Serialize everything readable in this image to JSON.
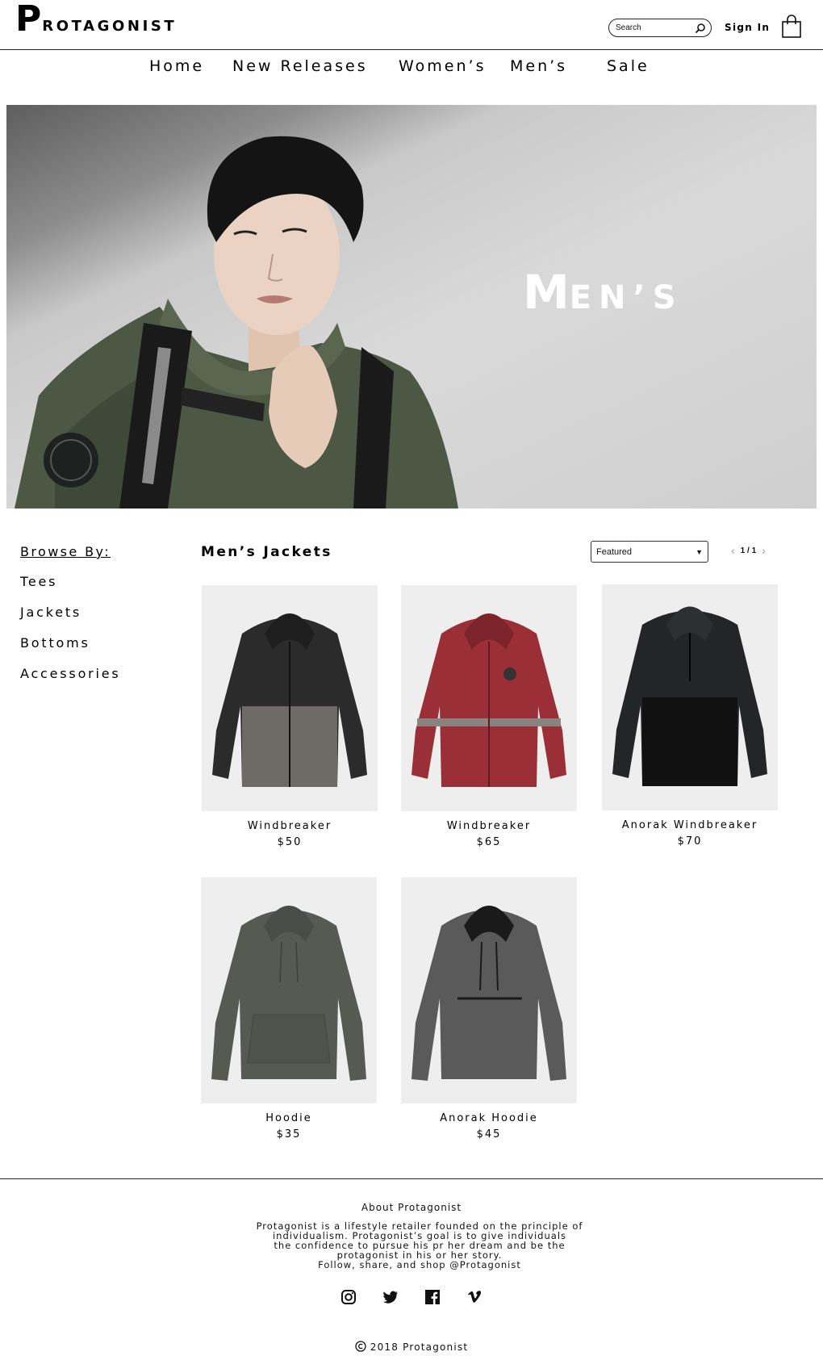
{
  "brand": {
    "initial": "P",
    "rest": "ROTAGONIST"
  },
  "header": {
    "search_placeholder": "Search",
    "signin_label": "Sign In"
  },
  "nav": {
    "items": [
      {
        "label": "Home"
      },
      {
        "label": "New Releases"
      },
      {
        "label": "Women’s"
      },
      {
        "label": "Men’s"
      },
      {
        "label": "Sale"
      }
    ]
  },
  "hero": {
    "title_first": "M",
    "title_rest": "EN’S"
  },
  "sidebar": {
    "title": "Browse By:",
    "items": [
      {
        "label": "Tees"
      },
      {
        "label": "Jackets"
      },
      {
        "label": "Bottoms"
      },
      {
        "label": "Accessories"
      }
    ]
  },
  "main": {
    "section_title": "Men’s Jackets",
    "sort": {
      "selected": "Featured"
    },
    "pager": {
      "text": "1 / 1"
    },
    "products": [
      {
        "name": "Windbreaker",
        "price": "$50",
        "colors": [
          "#2b2b2b",
          "#6e6b66"
        ]
      },
      {
        "name": "Windbreaker",
        "price": "$65",
        "colors": [
          "#9b2f37",
          "#8a8380"
        ]
      },
      {
        "name": "Anorak Windbreaker",
        "price": "$70",
        "colors": [
          "#232626",
          "#111111"
        ]
      },
      {
        "name": "Hoodie",
        "price": "$35",
        "colors": [
          "#575a53",
          "#575a53"
        ]
      },
      {
        "name": "Anorak Hoodie",
        "price": "$45",
        "colors": [
          "#5a5a5a",
          "#1a1a1a"
        ]
      }
    ]
  },
  "footer": {
    "about_title": "About Protagonist",
    "about_lines": [
      "Protagonist is a lifestyle retailer founded on the principle of",
      "individualism.  Protagonist’s goal is to give individuals",
      "the confidence to pursue his pr her dream and be the",
      "protagonist in his or her story.",
      "Follow, share, and shop @Protagonist"
    ],
    "social_icons": [
      "instagram-icon",
      "twitter-icon",
      "facebook-icon",
      "vimeo-icon"
    ],
    "copyright": "2018 Protagonist"
  }
}
